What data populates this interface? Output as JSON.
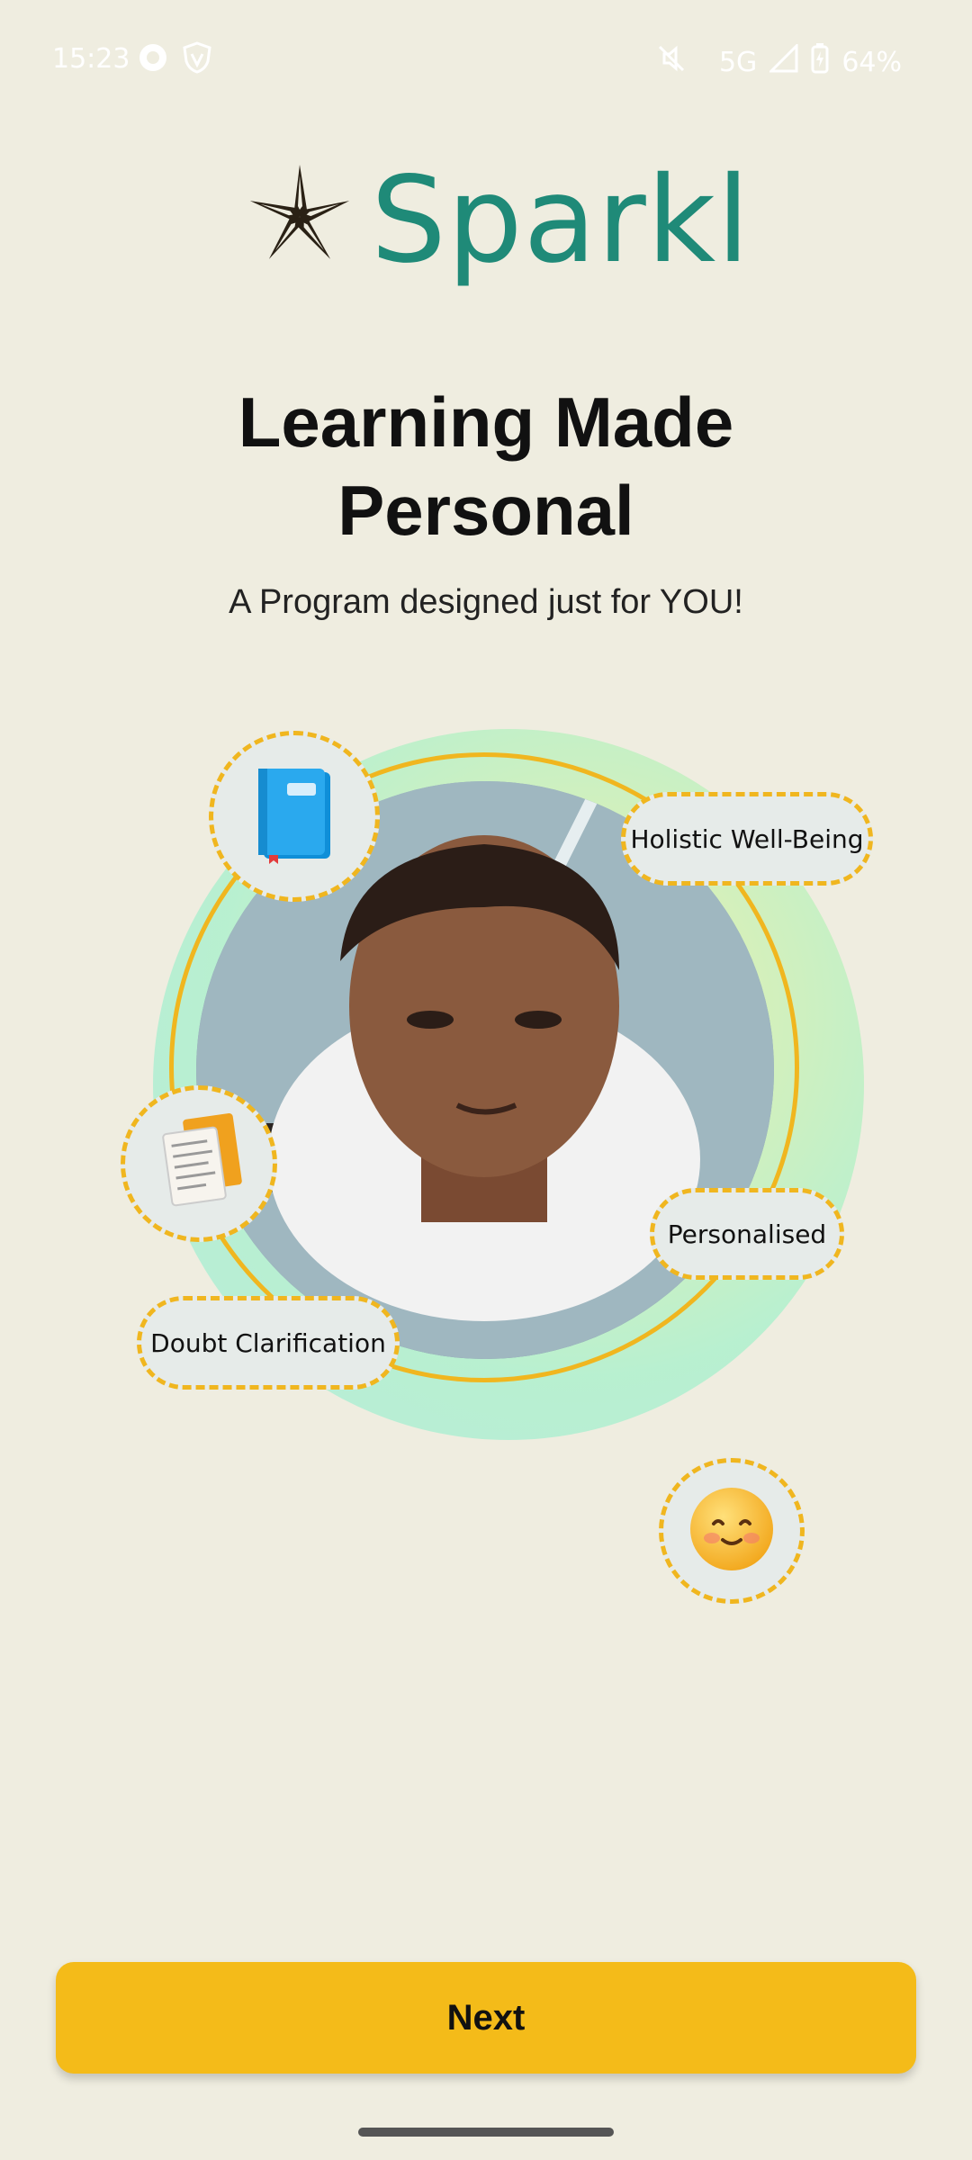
{
  "status_bar": {
    "time": "15:23",
    "network": "5G",
    "battery": "64%"
  },
  "logo": {
    "text": "Sparkl",
    "color": "#1f8a78"
  },
  "headline": {
    "line1": "Learning Made",
    "line2": "Personal"
  },
  "subtitle": "A Program designed just for YOU!",
  "tags": {
    "holistic": "Holistic Well-Being",
    "personalised": "Personalised",
    "doubt": "Doubt Clarification"
  },
  "icons": {
    "book": "book-icon",
    "documents": "documents-icon",
    "smiley": "smiley-icon"
  },
  "next_button": {
    "label": "Next",
    "color": "#f4bb19"
  }
}
